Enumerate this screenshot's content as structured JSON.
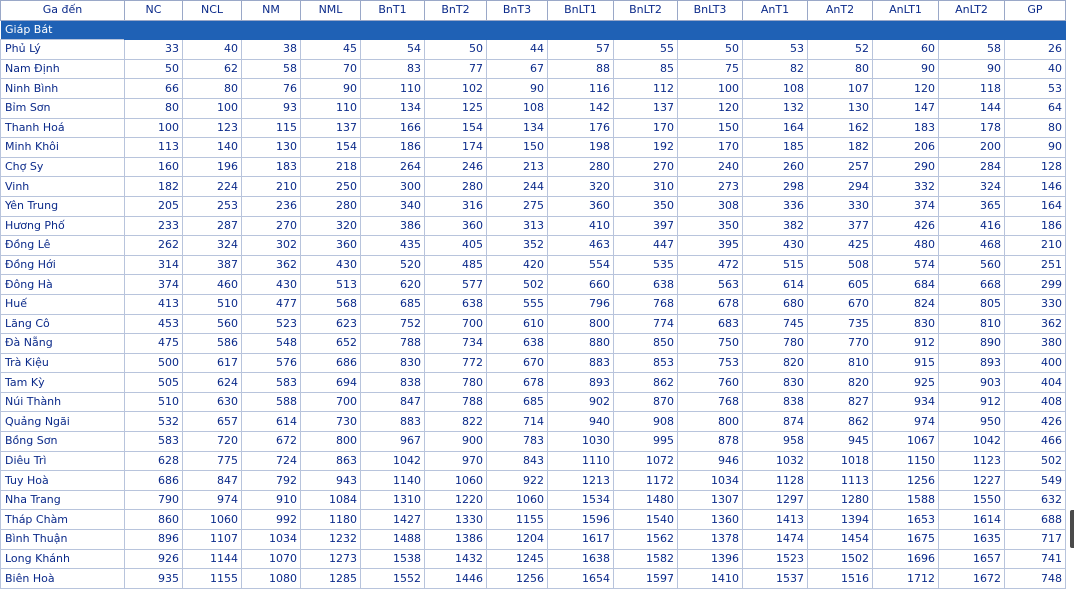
{
  "columns": [
    "Ga đến",
    "NC",
    "NCL",
    "NM",
    "NML",
    "BnT1",
    "BnT2",
    "BnT3",
    "BnLT1",
    "BnLT2",
    "BnLT3",
    "AnT1",
    "AnT2",
    "AnLT1",
    "AnLT2",
    "GP"
  ],
  "origin": "Giáp Bát",
  "rows": [
    [
      "Phủ Lý",
      "33",
      "40",
      "38",
      "45",
      "54",
      "50",
      "44",
      "57",
      "55",
      "50",
      "53",
      "52",
      "60",
      "58",
      "26"
    ],
    [
      "Nam Định",
      "50",
      "62",
      "58",
      "70",
      "83",
      "77",
      "67",
      "88",
      "85",
      "75",
      "82",
      "80",
      "90",
      "90",
      "40"
    ],
    [
      "Ninh Bình",
      "66",
      "80",
      "76",
      "90",
      "110",
      "102",
      "90",
      "116",
      "112",
      "100",
      "108",
      "107",
      "120",
      "118",
      "53"
    ],
    [
      "Bỉm Sơn",
      "80",
      "100",
      "93",
      "110",
      "134",
      "125",
      "108",
      "142",
      "137",
      "120",
      "132",
      "130",
      "147",
      "144",
      "64"
    ],
    [
      "Thanh Hoá",
      "100",
      "123",
      "115",
      "137",
      "166",
      "154",
      "134",
      "176",
      "170",
      "150",
      "164",
      "162",
      "183",
      "178",
      "80"
    ],
    [
      "Minh Khôi",
      "113",
      "140",
      "130",
      "154",
      "186",
      "174",
      "150",
      "198",
      "192",
      "170",
      "185",
      "182",
      "206",
      "200",
      "90"
    ],
    [
      "Chợ Sy",
      "160",
      "196",
      "183",
      "218",
      "264",
      "246",
      "213",
      "280",
      "270",
      "240",
      "260",
      "257",
      "290",
      "284",
      "128"
    ],
    [
      "Vinh",
      "182",
      "224",
      "210",
      "250",
      "300",
      "280",
      "244",
      "320",
      "310",
      "273",
      "298",
      "294",
      "332",
      "324",
      "146"
    ],
    [
      "Yên Trung",
      "205",
      "253",
      "236",
      "280",
      "340",
      "316",
      "275",
      "360",
      "350",
      "308",
      "336",
      "330",
      "374",
      "365",
      "164"
    ],
    [
      "Hương Phố",
      "233",
      "287",
      "270",
      "320",
      "386",
      "360",
      "313",
      "410",
      "397",
      "350",
      "382",
      "377",
      "426",
      "416",
      "186"
    ],
    [
      "Đồng Lê",
      "262",
      "324",
      "302",
      "360",
      "435",
      "405",
      "352",
      "463",
      "447",
      "395",
      "430",
      "425",
      "480",
      "468",
      "210"
    ],
    [
      "Đồng Hới",
      "314",
      "387",
      "362",
      "430",
      "520",
      "485",
      "420",
      "554",
      "535",
      "472",
      "515",
      "508",
      "574",
      "560",
      "251"
    ],
    [
      "Đông Hà",
      "374",
      "460",
      "430",
      "513",
      "620",
      "577",
      "502",
      "660",
      "638",
      "563",
      "614",
      "605",
      "684",
      "668",
      "299"
    ],
    [
      "Huế",
      "413",
      "510",
      "477",
      "568",
      "685",
      "638",
      "555",
      "796",
      "768",
      "678",
      "680",
      "670",
      "824",
      "805",
      "330"
    ],
    [
      "Lăng Cô",
      "453",
      "560",
      "523",
      "623",
      "752",
      "700",
      "610",
      "800",
      "774",
      "683",
      "745",
      "735",
      "830",
      "810",
      "362"
    ],
    [
      "Đà Nẵng",
      "475",
      "586",
      "548",
      "652",
      "788",
      "734",
      "638",
      "880",
      "850",
      "750",
      "780",
      "770",
      "912",
      "890",
      "380"
    ],
    [
      "Trà Kiệu",
      "500",
      "617",
      "576",
      "686",
      "830",
      "772",
      "670",
      "883",
      "853",
      "753",
      "820",
      "810",
      "915",
      "893",
      "400"
    ],
    [
      "Tam Kỳ",
      "505",
      "624",
      "583",
      "694",
      "838",
      "780",
      "678",
      "893",
      "862",
      "760",
      "830",
      "820",
      "925",
      "903",
      "404"
    ],
    [
      "Núi Thành",
      "510",
      "630",
      "588",
      "700",
      "847",
      "788",
      "685",
      "902",
      "870",
      "768",
      "838",
      "827",
      "934",
      "912",
      "408"
    ],
    [
      "Quảng Ngãi",
      "532",
      "657",
      "614",
      "730",
      "883",
      "822",
      "714",
      "940",
      "908",
      "800",
      "874",
      "862",
      "974",
      "950",
      "426"
    ],
    [
      "Bồng Sơn",
      "583",
      "720",
      "672",
      "800",
      "967",
      "900",
      "783",
      "1030",
      "995",
      "878",
      "958",
      "945",
      "1067",
      "1042",
      "466"
    ],
    [
      "Diêu Trì",
      "628",
      "775",
      "724",
      "863",
      "1042",
      "970",
      "843",
      "1110",
      "1072",
      "946",
      "1032",
      "1018",
      "1150",
      "1123",
      "502"
    ],
    [
      "Tuy Hoà",
      "686",
      "847",
      "792",
      "943",
      "1140",
      "1060",
      "922",
      "1213",
      "1172",
      "1034",
      "1128",
      "1113",
      "1256",
      "1227",
      "549"
    ],
    [
      "Nha Trang",
      "790",
      "974",
      "910",
      "1084",
      "1310",
      "1220",
      "1060",
      "1534",
      "1480",
      "1307",
      "1297",
      "1280",
      "1588",
      "1550",
      "632"
    ],
    [
      "Tháp Chàm",
      "860",
      "1060",
      "992",
      "1180",
      "1427",
      "1330",
      "1155",
      "1596",
      "1540",
      "1360",
      "1413",
      "1394",
      "1653",
      "1614",
      "688"
    ],
    [
      "Bình Thuận",
      "896",
      "1107",
      "1034",
      "1232",
      "1488",
      "1386",
      "1204",
      "1617",
      "1562",
      "1378",
      "1474",
      "1454",
      "1675",
      "1635",
      "717"
    ],
    [
      "Long Khánh",
      "926",
      "1144",
      "1070",
      "1273",
      "1538",
      "1432",
      "1245",
      "1638",
      "1582",
      "1396",
      "1523",
      "1502",
      "1696",
      "1657",
      "741"
    ],
    [
      "Biên Hoà",
      "935",
      "1155",
      "1080",
      "1285",
      "1552",
      "1446",
      "1256",
      "1654",
      "1597",
      "1410",
      "1537",
      "1516",
      "1712",
      "1672",
      "748"
    ]
  ]
}
